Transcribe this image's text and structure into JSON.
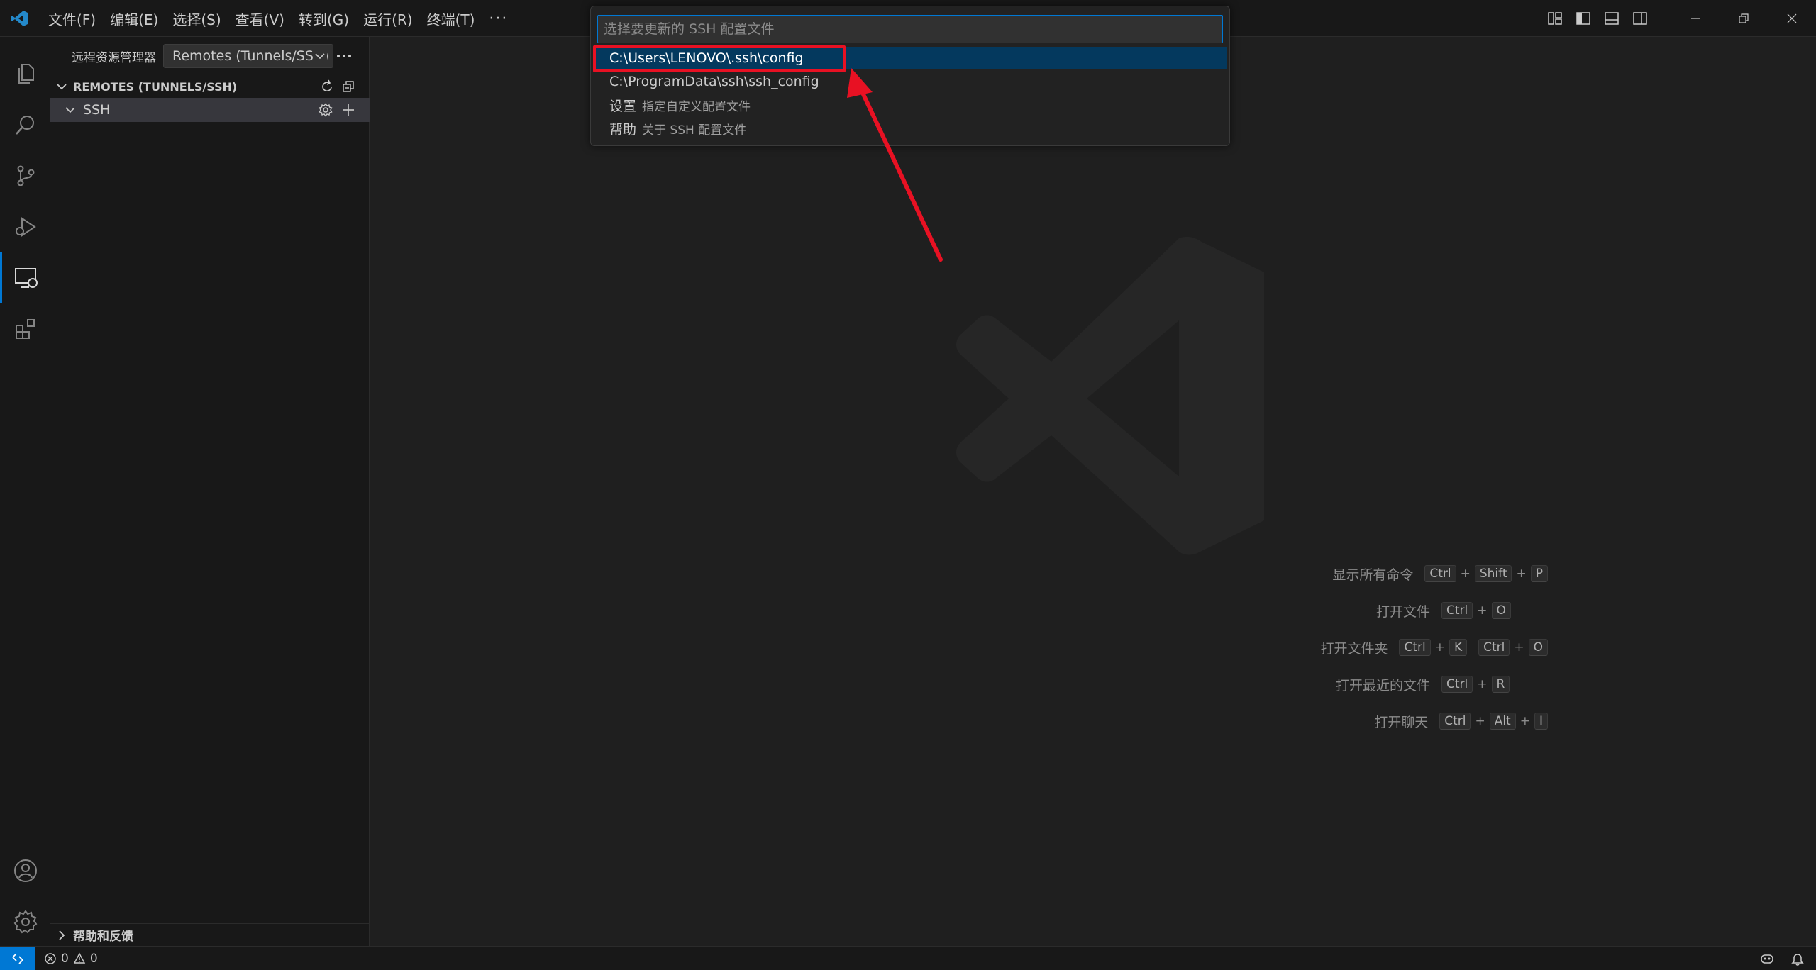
{
  "menu": {
    "items": [
      "文件(F)",
      "编辑(E)",
      "选择(S)",
      "查看(V)",
      "转到(G)",
      "运行(R)",
      "终端(T)"
    ],
    "more": "···"
  },
  "sidebar": {
    "title": "远程资源管理器",
    "select_value": "Remotes (Tunnels/SSH)",
    "section_title": "REMOTES (TUNNELS/SSH)",
    "ssh_label": "SSH",
    "help_title": "帮助和反馈"
  },
  "quickpick": {
    "placeholder": "选择要更新的 SSH 配置文件",
    "items": [
      {
        "label": "C:\\Users\\LENOVO\\.ssh\\config",
        "desc": ""
      },
      {
        "label": "C:\\ProgramData\\ssh\\ssh_config",
        "desc": ""
      },
      {
        "label": "设置",
        "desc": "指定自定义配置文件"
      },
      {
        "label": "帮助",
        "desc": "关于 SSH 配置文件"
      }
    ]
  },
  "shortcuts": [
    {
      "label": "显示所有命令",
      "keys": [
        [
          "Ctrl",
          "Shift",
          "P"
        ]
      ]
    },
    {
      "label": "打开文件",
      "keys": [
        [
          "Ctrl",
          "O"
        ]
      ]
    },
    {
      "label": "打开文件夹",
      "keys": [
        [
          "Ctrl",
          "K"
        ],
        [
          "Ctrl",
          "O"
        ]
      ]
    },
    {
      "label": "打开最近的文件",
      "keys": [
        [
          "Ctrl",
          "R"
        ]
      ]
    },
    {
      "label": "打开聊天",
      "keys": [
        [
          "Ctrl",
          "Alt",
          "I"
        ]
      ]
    }
  ],
  "status": {
    "errors": "0",
    "warnings": "0"
  },
  "colors": {
    "accent": "#0078d4",
    "selection": "#04395e",
    "highlight": "#e81123"
  }
}
